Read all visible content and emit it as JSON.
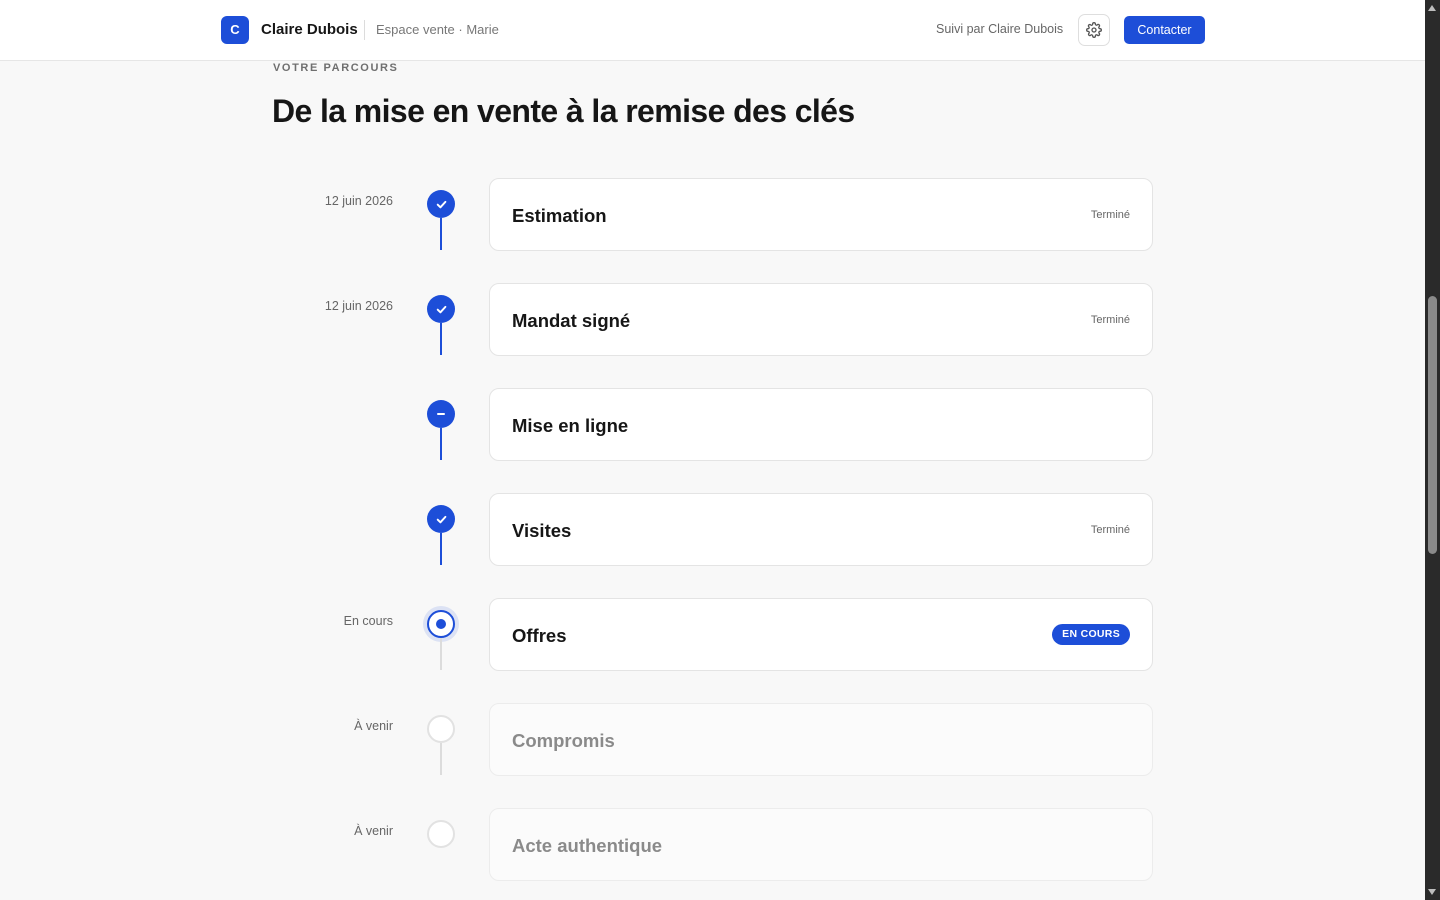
{
  "header": {
    "logo_letter": "C",
    "brand_name": "Claire Dubois",
    "subtitle": "Espace vente · Marie",
    "followed_by": "Suivi par Claire Dubois",
    "contact_label": "Contacter"
  },
  "section": {
    "eyebrow": "VOTRE PARCOURS",
    "title": "De la mise en vente à la remise des clés"
  },
  "colors": {
    "accent": "#1d4ed8",
    "pending_border": "#e2e2e2",
    "background": "#f8f8f8"
  },
  "steps": [
    {
      "date": "12 juin 2026",
      "title": "Estimation",
      "status": "Terminé",
      "state": "done"
    },
    {
      "date": "12 juin 2026",
      "title": "Mandat signé",
      "status": "Terminé",
      "state": "done"
    },
    {
      "date": "",
      "title": "Mise en ligne",
      "status": "",
      "state": "partial"
    },
    {
      "date": "",
      "title": "Visites",
      "status": "Terminé",
      "state": "done"
    },
    {
      "date": "En cours",
      "title": "Offres",
      "status": "EN COURS",
      "state": "current"
    },
    {
      "date": "À venir",
      "title": "Compromis",
      "status": "",
      "state": "pending"
    },
    {
      "date": "À venir",
      "title": "Acte authentique",
      "status": "",
      "state": "pending"
    }
  ]
}
